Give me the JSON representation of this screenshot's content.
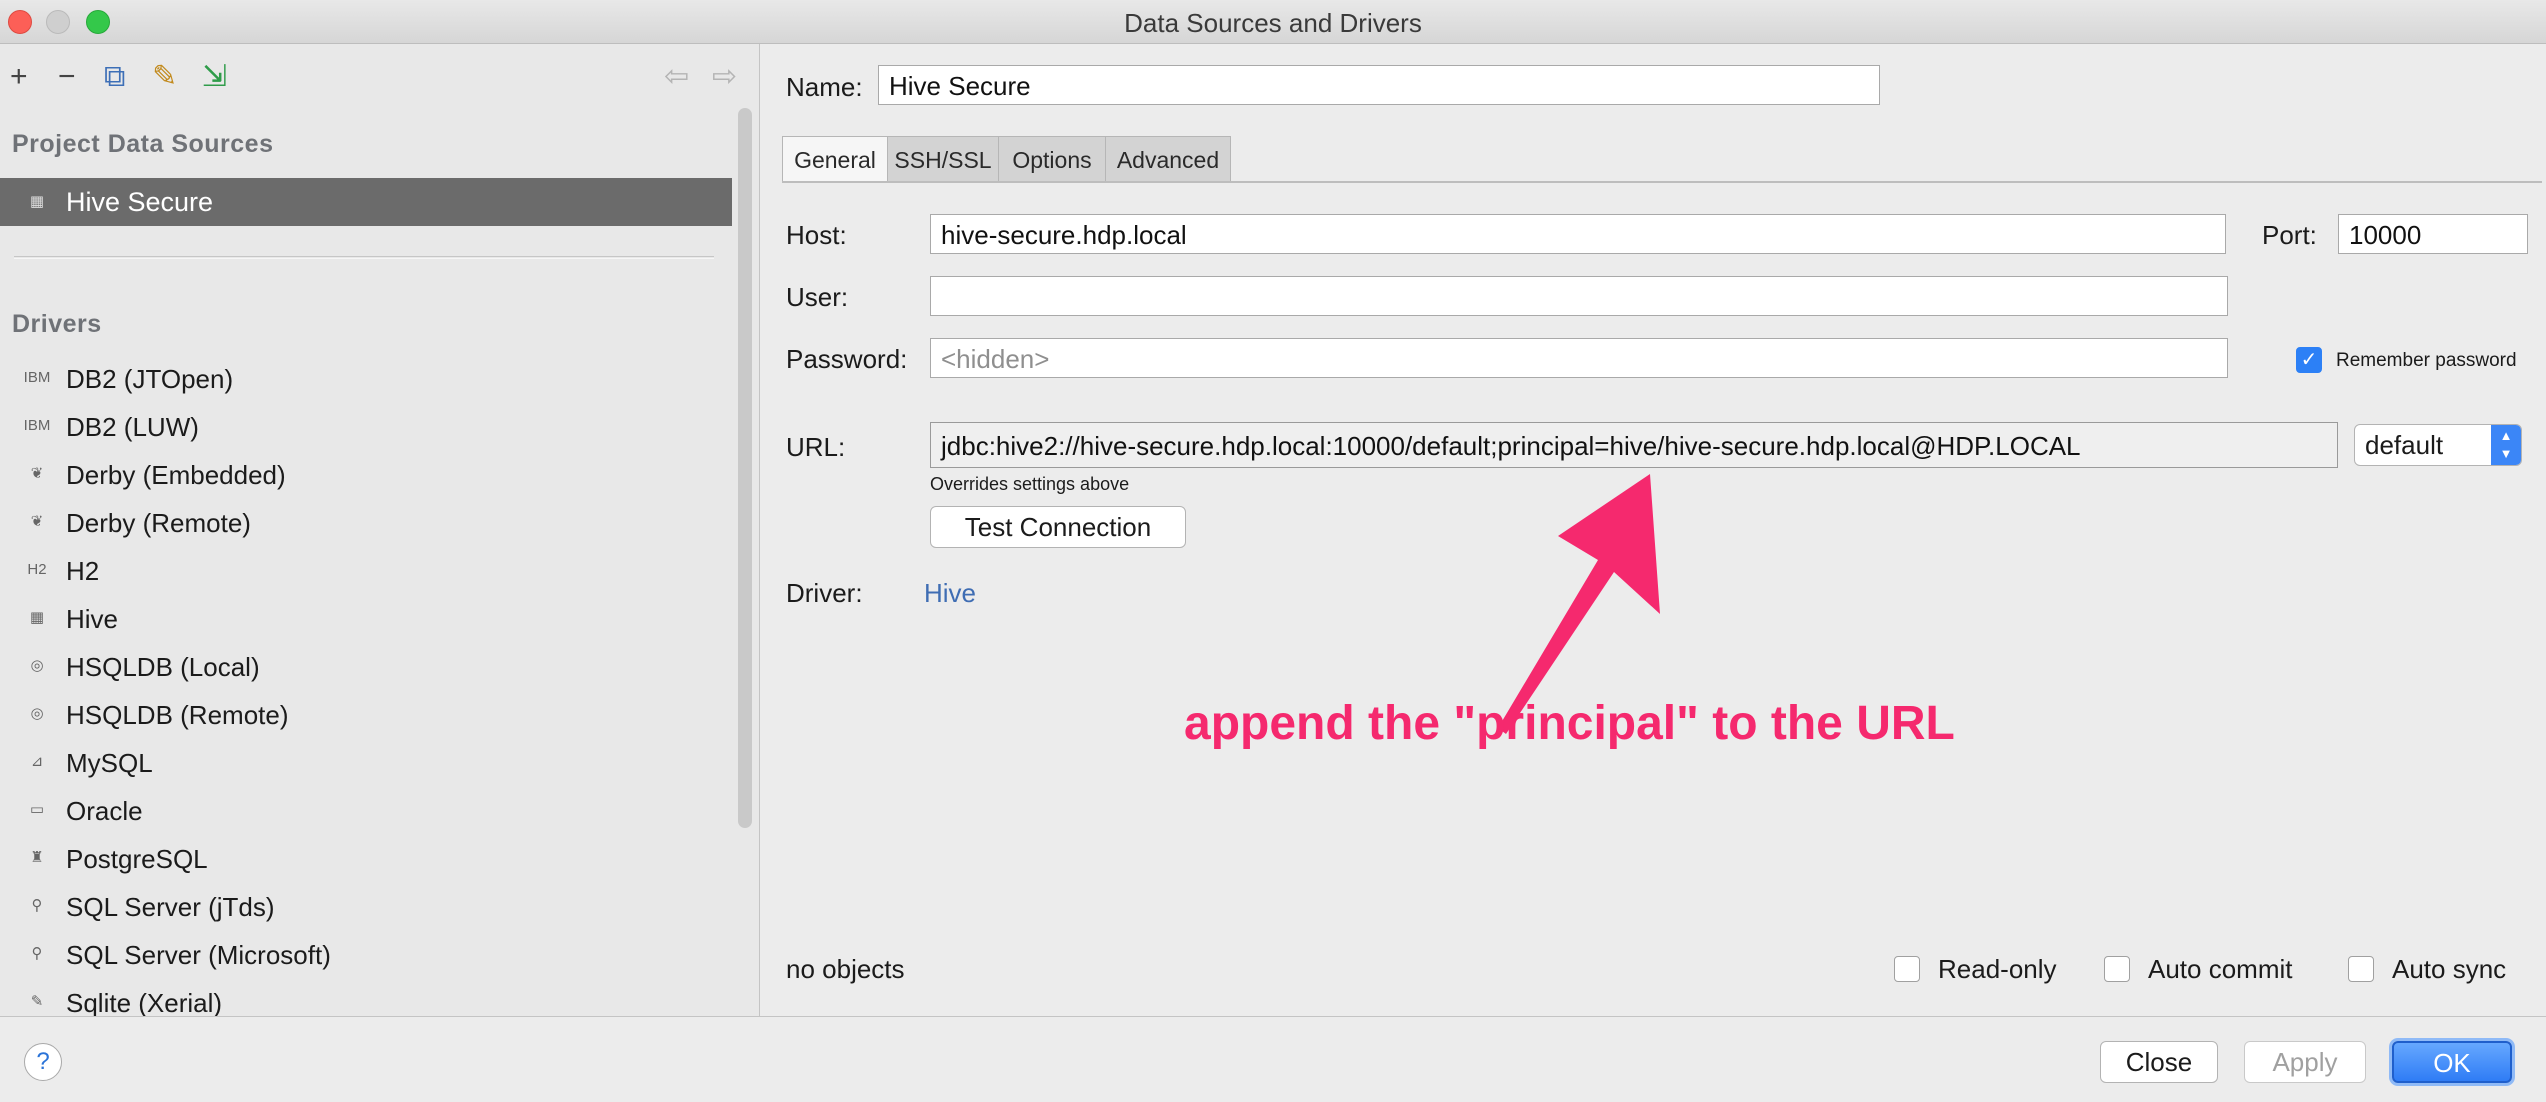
{
  "window": {
    "title": "Data Sources and Drivers"
  },
  "toolbar": {
    "add": "+",
    "remove": "−",
    "duplicate": "⧉",
    "properties": "✎",
    "import": "⇲",
    "back": "⇦",
    "forward": "⇨"
  },
  "sidebar": {
    "project_title": "Project Data Sources",
    "selected_item": {
      "label": "Hive Secure",
      "icon": "hive-icon"
    },
    "drivers_title": "Drivers",
    "drivers": [
      {
        "label": "DB2 (JTOpen)",
        "icon": "IBM"
      },
      {
        "label": "DB2 (LUW)",
        "icon": "IBM"
      },
      {
        "label": "Derby (Embedded)",
        "icon": "❦"
      },
      {
        "label": "Derby (Remote)",
        "icon": "❦"
      },
      {
        "label": "H2",
        "icon": "H2"
      },
      {
        "label": "Hive",
        "icon": "▦"
      },
      {
        "label": "HSQLDB (Local)",
        "icon": "◎"
      },
      {
        "label": "HSQLDB (Remote)",
        "icon": "◎"
      },
      {
        "label": "MySQL",
        "icon": "⊿"
      },
      {
        "label": "Oracle",
        "icon": "▭"
      },
      {
        "label": "PostgreSQL",
        "icon": "♜"
      },
      {
        "label": "SQL Server (jTds)",
        "icon": "⚲"
      },
      {
        "label": "SQL Server (Microsoft)",
        "icon": "⚲"
      },
      {
        "label": "Sqlite (Xerial)",
        "icon": "✎"
      }
    ]
  },
  "form": {
    "name_label": "Name:",
    "name_value": "Hive Secure",
    "tabs": [
      "General",
      "SSH/SSL",
      "Options",
      "Advanced"
    ],
    "host_label": "Host:",
    "host_value": "hive-secure.hdp.local",
    "port_label": "Port:",
    "port_value": "10000",
    "user_label": "User:",
    "user_value": "",
    "password_label": "Password:",
    "password_placeholder": "<hidden>",
    "remember_password": "Remember password",
    "url_label": "URL:",
    "url_value": "jdbc:hive2://hive-secure.hdp.local:10000/default;principal=hive/hive-secure.hdp.local@HDP.LOCAL",
    "url_mode": "default",
    "url_hint": "Overrides settings above",
    "test_connection": "Test Connection",
    "driver_label": "Driver:",
    "driver_value": "Hive",
    "annotation": "append the \"principal\" to the URL",
    "status": "no objects",
    "read_only": "Read-only",
    "auto_commit": "Auto commit",
    "auto_sync": "Auto sync"
  },
  "footer": {
    "help": "?",
    "close": "Close",
    "apply": "Apply",
    "ok": "OK"
  },
  "colors": {
    "accent": "#2c80f6",
    "annotation": "#f5296e",
    "link": "#3f6db3"
  }
}
